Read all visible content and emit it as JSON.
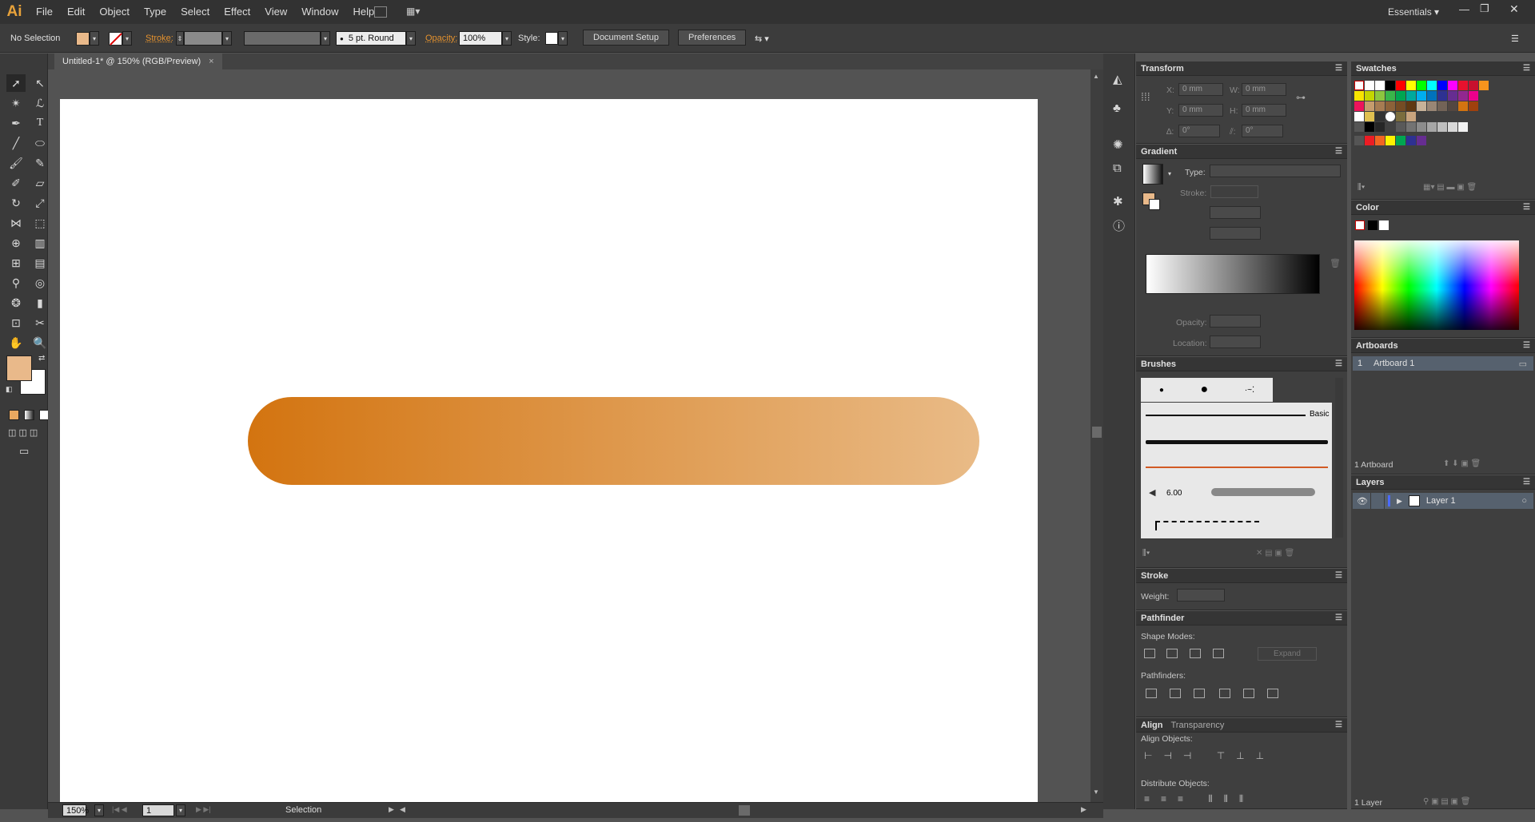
{
  "app": {
    "logo": "Ai",
    "workspace": "Essentials"
  },
  "menus": [
    "File",
    "Edit",
    "Object",
    "Type",
    "Select",
    "Effect",
    "View",
    "Window",
    "Help"
  ],
  "control": {
    "selection": "No Selection",
    "stroke_label": "Stroke:",
    "brush": "5 pt. Round",
    "opacity_label": "Opacity:",
    "opacity_value": "100%",
    "style_label": "Style:",
    "document_setup": "Document Setup",
    "preferences": "Preferences"
  },
  "document": {
    "tab_title": "Untitled-1* @ 150% (RGB/Preview)"
  },
  "status": {
    "zoom": "150%",
    "artboard_num": "1",
    "tool": "Selection"
  },
  "transform": {
    "title": "Transform",
    "x_label": "X:",
    "x": "0 mm",
    "w_label": "W:",
    "w": "0 mm",
    "y_label": "Y:",
    "y": "0 mm",
    "h_label": "H:",
    "h": "0 mm",
    "rot": "0°",
    "shear": "0°"
  },
  "gradient": {
    "title": "Gradient",
    "type_label": "Type:",
    "stroke_label": "Stroke:",
    "opacity_label": "Opacity:",
    "location_label": "Location:"
  },
  "brushes": {
    "title": "Brushes",
    "basic": "Basic",
    "size": "6.00"
  },
  "stroke": {
    "title": "Stroke",
    "weight_label": "Weight:"
  },
  "pathfinder": {
    "title": "Pathfinder",
    "shape_modes": "Shape Modes:",
    "expand": "Expand",
    "pathfinders": "Pathfinders:"
  },
  "align": {
    "title": "Align",
    "tab2": "Transparency",
    "align_objects": "Align Objects:",
    "distribute_objects": "Distribute Objects:"
  },
  "swatches": {
    "title": "Swatches"
  },
  "color": {
    "title": "Color"
  },
  "artboards": {
    "title": "Artboards",
    "row_num": "1",
    "row_name": "Artboard 1",
    "count": "1 Artboard"
  },
  "layers": {
    "title": "Layers",
    "layer_name": "Layer 1",
    "count": "1 Layer"
  },
  "colors": {
    "fill": "#e9b98a",
    "gradient_start": "#d37410",
    "gradient_end": "#e9bb87",
    "accent": "#e5922e"
  }
}
